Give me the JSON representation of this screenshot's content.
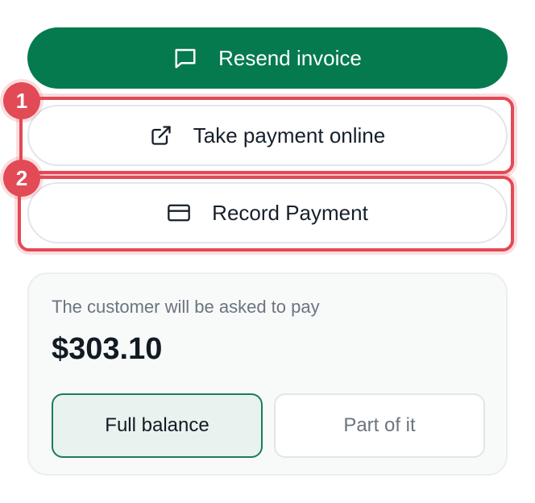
{
  "actions": {
    "resend_label": "Resend invoice",
    "online_label": "Take payment online",
    "record_label": "Record Payment"
  },
  "annotations": {
    "marker_1": "1",
    "marker_2": "2"
  },
  "payment_card": {
    "label": "The customer will be asked to pay",
    "amount": "$303.10",
    "options": [
      "Full balance",
      "Part of it"
    ],
    "selected": "Full balance"
  },
  "icons": {
    "resend": "message-square-icon",
    "online": "external-link-icon",
    "record": "credit-card-icon"
  },
  "colors": {
    "primary": "#057a4f",
    "highlight": "#e24a55",
    "selected_bg": "#e8f2ee"
  }
}
